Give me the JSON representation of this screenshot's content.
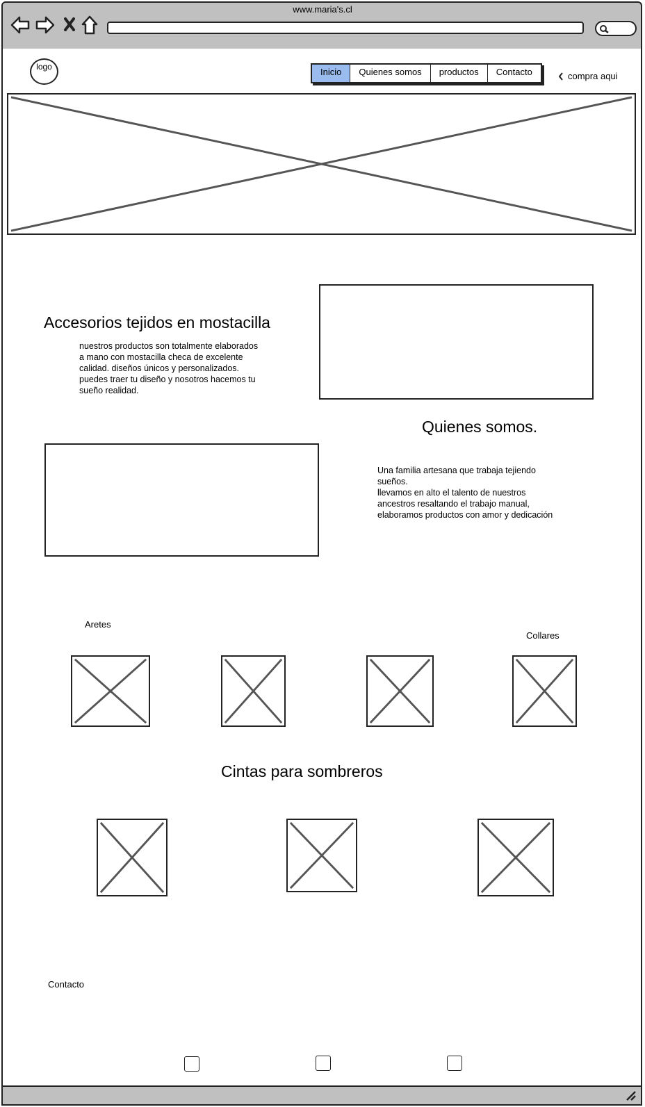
{
  "browser": {
    "url": "www.maria's.cl",
    "icons": [
      "back-arrow-icon",
      "forward-arrow-icon",
      "close-icon",
      "home-icon",
      "search-icon",
      "resize-grip-icon"
    ]
  },
  "header": {
    "logo_text": "logo",
    "nav": [
      {
        "label": "Inicio",
        "active": true
      },
      {
        "label": "Quienes somos",
        "active": false
      },
      {
        "label": "productos",
        "active": false
      },
      {
        "label": "Contacto",
        "active": false
      }
    ],
    "buy_link": "compra aqui",
    "active_color": "#99bbee"
  },
  "intro": {
    "title": "Accesorios tejidos en mostacilla",
    "text": "nuestros productos son totalmente elaborados\na mano con mostacilla checa de excelente\ncalidad. diseños únicos y personalizados.\npuedes traer tu diseño y nosotros hacemos tu\nsueño realidad."
  },
  "about": {
    "title": "Quienes somos.",
    "text": " Una familia artesana que trabaja tejiendo\nsueños.\nllevamos en alto el talento de nuestros\nancestros resaltando el trabajo manual,\nelaboramos productos con amor y dedicación"
  },
  "products": {
    "aretes_label": "Aretes",
    "collares_label": "Collares",
    "cintas_title": "Cintas para sombreros"
  },
  "contact": {
    "label": "Contacto"
  }
}
